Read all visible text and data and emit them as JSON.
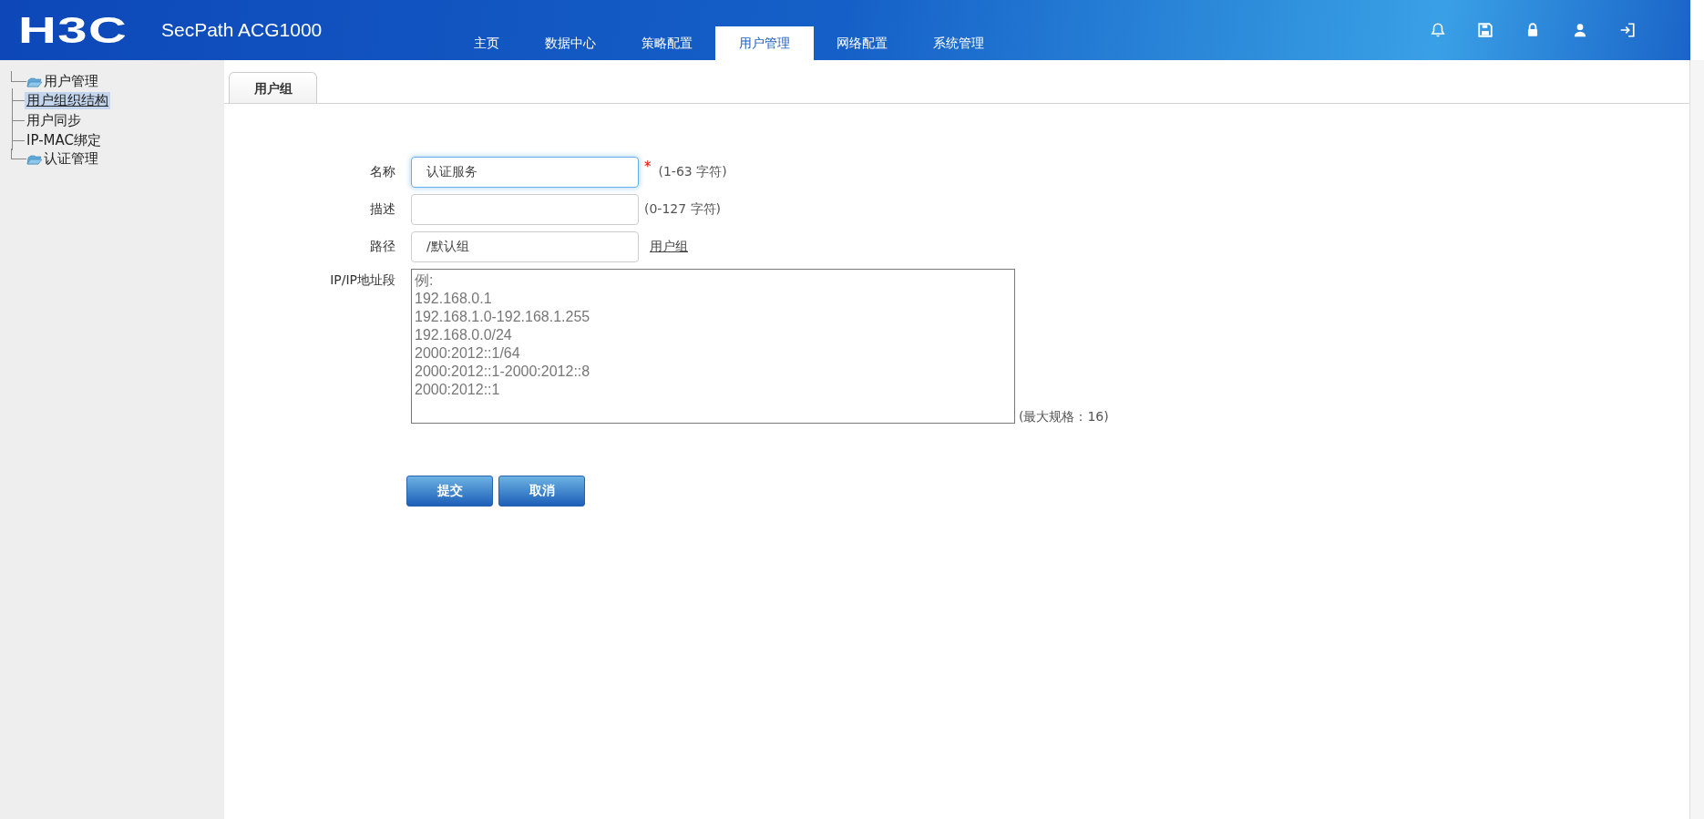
{
  "header": {
    "logo": "H3C",
    "product": "SecPath ACG1000",
    "nav": [
      {
        "label": "主页",
        "selected": false
      },
      {
        "label": "数据中心",
        "selected": false
      },
      {
        "label": "策略配置",
        "selected": false
      },
      {
        "label": "用户管理",
        "selected": true
      },
      {
        "label": "网络配置",
        "selected": false
      },
      {
        "label": "系统管理",
        "selected": false
      }
    ],
    "toolbar": [
      {
        "kind": "bell"
      },
      {
        "kind": "save"
      },
      {
        "kind": "lock"
      },
      {
        "kind": "user"
      },
      {
        "kind": "logout"
      }
    ]
  },
  "sidebar": {
    "tree": [
      {
        "label": "用户管理",
        "children": [
          {
            "label": "用户组织结构",
            "selected": true
          },
          {
            "label": "用户同步",
            "selected": false
          },
          {
            "label": "IP-MAC绑定",
            "selected": false
          }
        ]
      },
      {
        "label": "认证管理"
      }
    ]
  },
  "tabs": [
    {
      "label": "用户组",
      "selected": true
    }
  ],
  "form": {
    "fields": [
      {
        "kind": "input",
        "label": "名称",
        "value": "认证服务",
        "focused": true,
        "required_mark": "*",
        "hint": "(1-63 字符)"
      },
      {
        "kind": "input",
        "label": "描述",
        "focused": false,
        "hint": "(0-127 字符)"
      },
      {
        "kind": "input",
        "label": "路径",
        "value": "/默认组",
        "focused": false,
        "link": "用户组"
      },
      {
        "kind": "textarea",
        "label": "IP/IP地址段",
        "placeholder": "例:\n192.168.0.1\n192.168.1.0-192.168.1.255\n192.168.0.0/24\n2000:2012::1/64\n2000:2012::1-2000:2012::8\n2000:2012::1",
        "hint": "(最大规格：16)"
      }
    ],
    "buttons": [
      "提交",
      "取消"
    ]
  }
}
